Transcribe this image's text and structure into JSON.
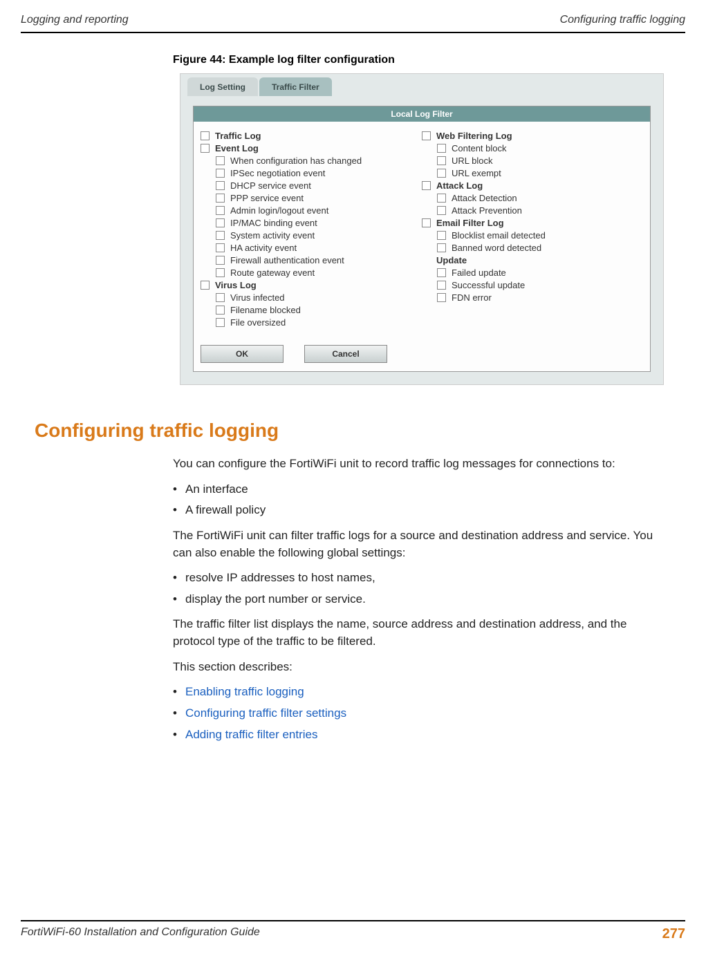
{
  "header": {
    "left": "Logging and reporting",
    "right": "Configuring traffic logging"
  },
  "figure_caption": "Figure 44: Example log filter configuration",
  "tabs": {
    "log_setting": "Log Setting",
    "traffic_filter": "Traffic Filter"
  },
  "filter_panel": {
    "title": "Local Log Filter",
    "left_col": {
      "traffic_log": "Traffic Log",
      "event_log": "Event Log",
      "event_items": [
        "When configuration has changed",
        "IPSec negotiation event",
        "DHCP service event",
        "PPP service event",
        "Admin login/logout event",
        "IP/MAC binding event",
        "System activity event",
        "HA activity event",
        "Firewall authentication event",
        "Route gateway event"
      ],
      "virus_log": "Virus Log",
      "virus_items": [
        "Virus infected",
        "Filename blocked",
        "File oversized"
      ]
    },
    "right_col": {
      "web_filtering_log": "Web Filtering Log",
      "web_items": [
        "Content block",
        "URL block",
        "URL exempt"
      ],
      "attack_log": "Attack Log",
      "attack_items": [
        "Attack Detection",
        "Attack Prevention"
      ],
      "email_filter_log": "Email Filter Log",
      "email_items": [
        "Blocklist email detected",
        "Banned word detected"
      ],
      "update": "Update",
      "update_items": [
        "Failed update",
        "Successful update",
        "FDN error"
      ]
    },
    "buttons": {
      "ok": "OK",
      "cancel": "Cancel"
    }
  },
  "section_heading": "Configuring traffic logging",
  "body": {
    "p1": "You can configure the FortiWiFi unit to record traffic log messages for connections to:",
    "list1": [
      "An interface",
      "A firewall policy"
    ],
    "p2": "The FortiWiFi unit can filter traffic logs for a source and destination address and service. You can also enable the following global settings:",
    "list2": [
      "resolve IP addresses to host names,",
      "display the port number or service."
    ],
    "p3": "The traffic filter list displays the name, source address and destination address, and the protocol type of the traffic to be filtered.",
    "p4": "This section describes:",
    "list3": [
      "Enabling traffic logging",
      "Configuring traffic filter settings",
      "Adding traffic filter entries"
    ]
  },
  "footer": {
    "left": "FortiWiFi-60 Installation and Configuration Guide",
    "page": "277"
  }
}
